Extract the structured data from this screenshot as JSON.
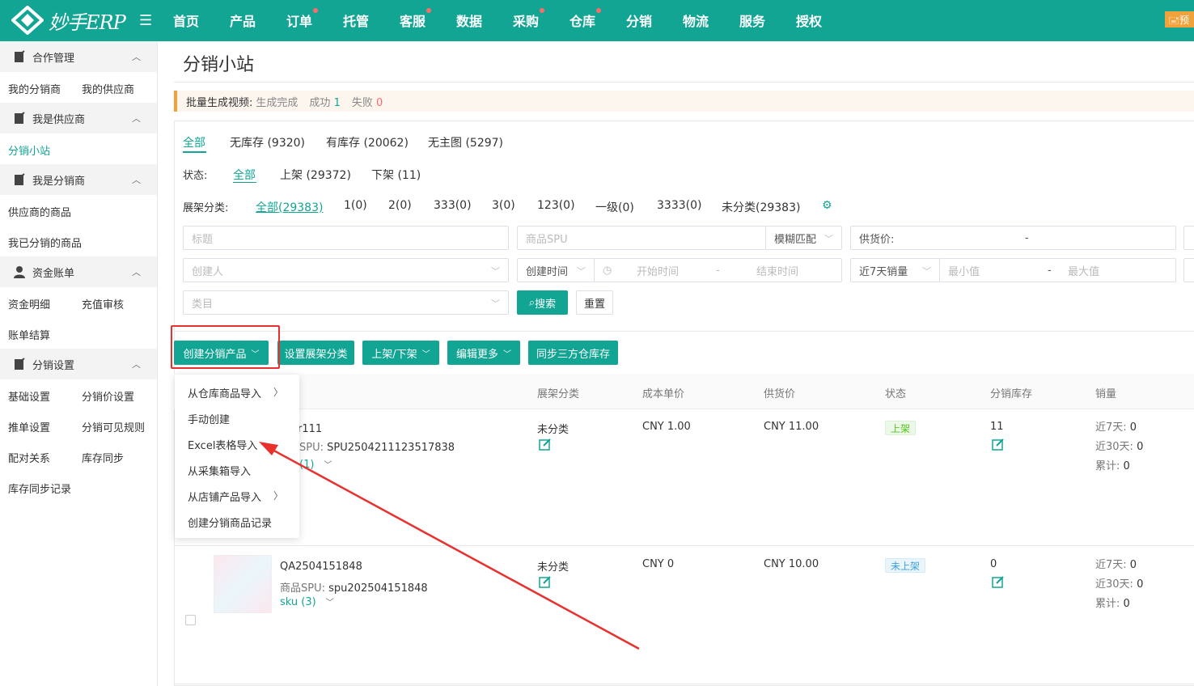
{
  "app": {
    "logo_text": "妙手ERP",
    "top_right": "预"
  },
  "topnav": [
    {
      "label": "首页",
      "dot": false
    },
    {
      "label": "产品",
      "dot": false
    },
    {
      "label": "订单",
      "dot": true
    },
    {
      "label": "托管",
      "dot": false
    },
    {
      "label": "客服",
      "dot": true
    },
    {
      "label": "数据",
      "dot": false
    },
    {
      "label": "采购",
      "dot": true
    },
    {
      "label": "仓库",
      "dot": true
    },
    {
      "label": "分销",
      "dot": false
    },
    {
      "label": "物流",
      "dot": false
    },
    {
      "label": "服务",
      "dot": false
    },
    {
      "label": "授权",
      "dot": false
    }
  ],
  "sidebar": {
    "sec1": "合作管理",
    "sec1_links": [
      "我的分销商",
      "我的供应商"
    ],
    "sec2": "我是供应商",
    "sec2_links": [
      "分销小站"
    ],
    "sec3": "我是分销商",
    "sec3_links": [
      "供应商的商品",
      "我已分销的商品"
    ],
    "sec4": "资金账单",
    "sec4_links": [
      "资金明细",
      "充值审核",
      "账单结算"
    ],
    "sec5": "分销设置",
    "sec5_links": [
      "基础设置",
      "分销价设置",
      "推单设置",
      "分销可见规则",
      "配对关系",
      "库存同步",
      "库存同步记录"
    ]
  },
  "page_title": "分销小站",
  "notice": {
    "label": "批量生成视频:",
    "status": "生成完成",
    "success_label": "成功",
    "success_count": "1",
    "fail_label": "失败",
    "fail_count": "0"
  },
  "tabs": [
    "全部",
    "无库存 (9320)",
    "有库存 (20062)",
    "无主图 (5297)"
  ],
  "status_label": "状态:",
  "status_opts": [
    "全部",
    "上架 (29372)",
    "下架 (11)"
  ],
  "shelf_label": "展架分类:",
  "shelf_opts": [
    "全部(29383)",
    "1(0)",
    "2(0)",
    "333(0)",
    "3(0)",
    "123(0)",
    "一级(0)",
    "3333(0)",
    "未分类(29383)"
  ],
  "filters": {
    "title_ph": "标题",
    "spu_ph": "商品SPU",
    "match": "模糊匹配",
    "supply_price": "供货价:",
    "dash": "-",
    "creator_ph": "创建人",
    "created_time": "创建时间",
    "start_ph": "开始时间",
    "end_ph": "结束时间",
    "sales7": "近7天销量",
    "min_ph": "最小值",
    "max_ph": "最大值",
    "category_ph": "类目",
    "search": "搜索",
    "reset": "重置"
  },
  "actions": [
    "创建分销产品",
    "设置展架分类",
    "上架/下架",
    "编辑更多",
    "同步三方仓库存"
  ],
  "columns": [
    "展架分类",
    "成本单价",
    "供货价",
    "状态",
    "分销库存",
    "销量"
  ],
  "dropdown": [
    "从仓库商品导入",
    "手动创建",
    "Excel表格导入",
    "从采集箱导入",
    "从店铺产品导入",
    "创建分销商品记录"
  ],
  "rows": [
    {
      "title": "r111",
      "spu_label": "SPU:",
      "spu": "SPU2504211123517838",
      "sku": "(1)",
      "shelf": "未分类",
      "cost": "CNY 1.00",
      "price": "CNY 11.00",
      "status": "上架",
      "stock": "11",
      "s7": "近7天:",
      "v7": "0",
      "s30": "近30天:",
      "v30": "0",
      "tot": "累计:",
      "vt": "0"
    },
    {
      "title": "QA2504151848",
      "spu_label": "商品SPU:",
      "spu": "spu202504151848",
      "sku": "sku (3)",
      "shelf": "未分类",
      "cost": "CNY 0",
      "price": "CNY 10.00",
      "status": "未上架",
      "stock": "0",
      "s7": "近7天:",
      "v7": "0",
      "s30": "近30天:",
      "v30": "0",
      "tot": "累计:",
      "vt": "0"
    }
  ]
}
